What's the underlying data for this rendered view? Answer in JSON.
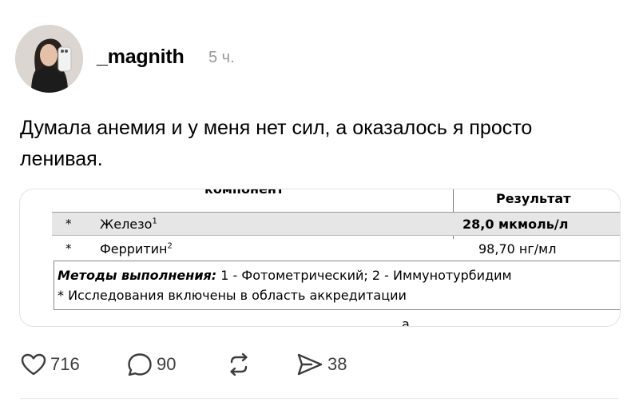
{
  "post": {
    "username": "_magnith",
    "time": "5 ч.",
    "text": "Думала анемия и у меня нет сил, а оказалось я просто ленивая."
  },
  "lab_result": {
    "header_component": "компонент",
    "header_result": "Результат",
    "rows": [
      {
        "marker": "*",
        "name": "Железо",
        "note": "1",
        "value": "28,0 мкмоль/л"
      },
      {
        "marker": "*",
        "name": "Ферритин",
        "note": "2",
        "value": "98,70 нг/мл"
      }
    ],
    "methods_label": "Методы выполнения:",
    "methods_text": " 1 - Фотометрический; 2 - Иммунотурбидим",
    "accreditation": "* Исследования включены в область аккредитации",
    "signature_mark": "а"
  },
  "actions": {
    "likes": "716",
    "comments": "90",
    "shares": "38"
  },
  "icons": [
    "heart-icon",
    "comment-icon",
    "repost-icon",
    "share-icon"
  ]
}
